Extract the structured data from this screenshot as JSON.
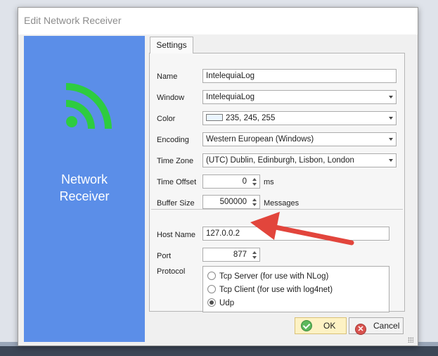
{
  "window": {
    "title": "Edit Network Receiver"
  },
  "left_panel": {
    "caption_line1": "Network",
    "caption_line2": "Receiver",
    "accent": "#5b8ee8",
    "icon": "wifi-signal-icon",
    "icon_color": "#2ecc40"
  },
  "tabs": [
    {
      "label": "Settings"
    }
  ],
  "form": {
    "name": {
      "label": "Name",
      "value": "IntelequiaLog"
    },
    "window": {
      "label": "Window",
      "value": "IntelequiaLog"
    },
    "color": {
      "label": "Color",
      "value": "235, 245, 255",
      "swatch": "#ebf5ff"
    },
    "encoding": {
      "label": "Encoding",
      "value": "Western European (Windows)"
    },
    "time_zone": {
      "label": "Time Zone",
      "value": "(UTC) Dublin, Edinburgh, Lisbon, London"
    },
    "time_offset": {
      "label": "Time Offset",
      "value": "0",
      "unit": "ms"
    },
    "buffer_size": {
      "label": "Buffer Size",
      "value": "500000",
      "unit": "Messages"
    },
    "host_name": {
      "label": "Host Name",
      "value": "127.0.0.2"
    },
    "port": {
      "label": "Port",
      "value": "877"
    },
    "protocol": {
      "label": "Protocol",
      "options": [
        {
          "label": "Tcp Server (for use with NLog)",
          "checked": false
        },
        {
          "label": "Tcp Client (for use with log4net)",
          "checked": false
        },
        {
          "label": "Udp",
          "checked": true
        }
      ]
    }
  },
  "buttons": {
    "ok": "OK",
    "cancel": "Cancel"
  },
  "annotation": {
    "color": "#e2453c"
  }
}
